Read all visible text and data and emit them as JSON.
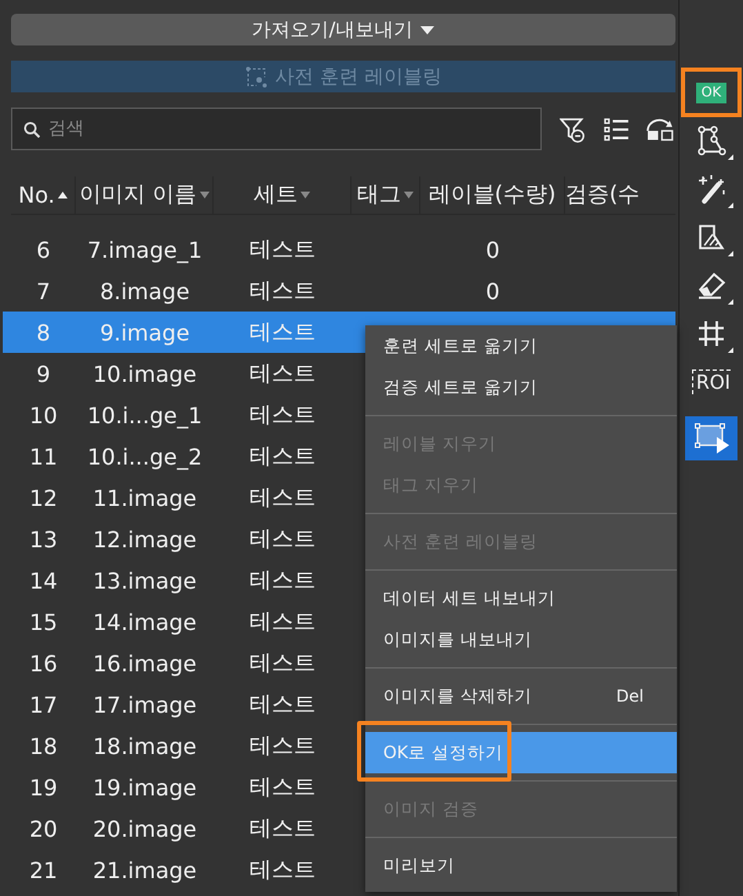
{
  "import_export_button": {
    "label": "가져오기/내보내기"
  },
  "pretrain_button": {
    "label": "사전 훈련 레이블링",
    "disabled": true
  },
  "search": {
    "placeholder": "검색"
  },
  "table": {
    "columns": [
      {
        "label": "No.",
        "kind": "sorted"
      },
      {
        "label": "이미지 이름",
        "kind": "filter"
      },
      {
        "label": "세트",
        "kind": "filter"
      },
      {
        "label": "태그",
        "kind": "filter"
      },
      {
        "label": "레이블(수량)",
        "kind": "plain"
      },
      {
        "label": "검증(수",
        "kind": "plain"
      }
    ],
    "rows": [
      {
        "no": "6",
        "name": "7.image_1",
        "set": "테스트",
        "labels": "0",
        "selected": false
      },
      {
        "no": "7",
        "name": "8.image",
        "set": "테스트",
        "labels": "0",
        "selected": false
      },
      {
        "no": "8",
        "name": "9.image",
        "set": "테스트",
        "selected": true
      },
      {
        "no": "9",
        "name": "10.image",
        "set": "테스트",
        "selected": false
      },
      {
        "no": "10",
        "name": "10.i...ge_1",
        "set": "테스트",
        "selected": false
      },
      {
        "no": "11",
        "name": "10.i...ge_2",
        "set": "테스트",
        "selected": false
      },
      {
        "no": "12",
        "name": "11.image",
        "set": "테스트",
        "selected": false
      },
      {
        "no": "13",
        "name": "12.image",
        "set": "테스트",
        "selected": false
      },
      {
        "no": "14",
        "name": "13.image",
        "set": "테스트",
        "selected": false
      },
      {
        "no": "15",
        "name": "14.image",
        "set": "테스트",
        "selected": false
      },
      {
        "no": "16",
        "name": "16.image",
        "set": "테스트",
        "selected": false
      },
      {
        "no": "17",
        "name": "17.image",
        "set": "테스트",
        "selected": false
      },
      {
        "no": "18",
        "name": "18.image",
        "set": "테스트",
        "selected": false
      },
      {
        "no": "19",
        "name": "19.image",
        "set": "테스트",
        "selected": false
      },
      {
        "no": "20",
        "name": "20.image",
        "set": "테스트",
        "selected": false
      },
      {
        "no": "21",
        "name": "21.image",
        "set": "테스트",
        "selected": false
      }
    ]
  },
  "context_menu": {
    "groups": [
      [
        {
          "label": "훈련 세트로 옮기기",
          "disabled": false,
          "highlighted": false,
          "annotated": false
        },
        {
          "label": "검증 세트로 옮기기",
          "disabled": false,
          "highlighted": false,
          "annotated": false
        }
      ],
      [
        {
          "label": "레이블 지우기",
          "disabled": true,
          "highlighted": false,
          "annotated": false
        },
        {
          "label": "태그 지우기",
          "disabled": true,
          "highlighted": false,
          "annotated": false
        }
      ],
      [
        {
          "label": "사전 훈련 레이블링",
          "disabled": true,
          "highlighted": false,
          "annotated": false
        }
      ],
      [
        {
          "label": "데이터 세트 내보내기",
          "disabled": false,
          "highlighted": false,
          "annotated": false
        },
        {
          "label": "이미지를 내보내기",
          "disabled": false,
          "highlighted": false,
          "annotated": false
        }
      ],
      [
        {
          "label": "이미지를 삭제하기",
          "shortcut": "Del",
          "disabled": false,
          "highlighted": false,
          "annotated": false
        }
      ],
      [
        {
          "label": "OK로 설정하기",
          "disabled": false,
          "highlighted": true,
          "annotated": true
        }
      ],
      [
        {
          "label": "이미지 검증",
          "disabled": true,
          "highlighted": false,
          "annotated": false
        }
      ],
      [
        {
          "label": "미리보기",
          "disabled": false,
          "highlighted": false,
          "annotated": false
        }
      ]
    ]
  },
  "toolbar": {
    "tools": [
      {
        "kind": "ok",
        "text": "OK",
        "selected": false,
        "annotated": true
      },
      {
        "kind": "polygon",
        "selected": false,
        "annotated": false
      },
      {
        "kind": "wand",
        "selected": false,
        "annotated": false
      },
      {
        "kind": "fill",
        "selected": false,
        "annotated": false
      },
      {
        "kind": "eraser",
        "selected": false,
        "annotated": false
      },
      {
        "kind": "grid",
        "selected": false,
        "annotated": false
      },
      {
        "kind": "roi",
        "text": "ROI",
        "selected": false,
        "annotated": false
      },
      {
        "kind": "rect",
        "selected": true,
        "annotated": false
      }
    ]
  }
}
